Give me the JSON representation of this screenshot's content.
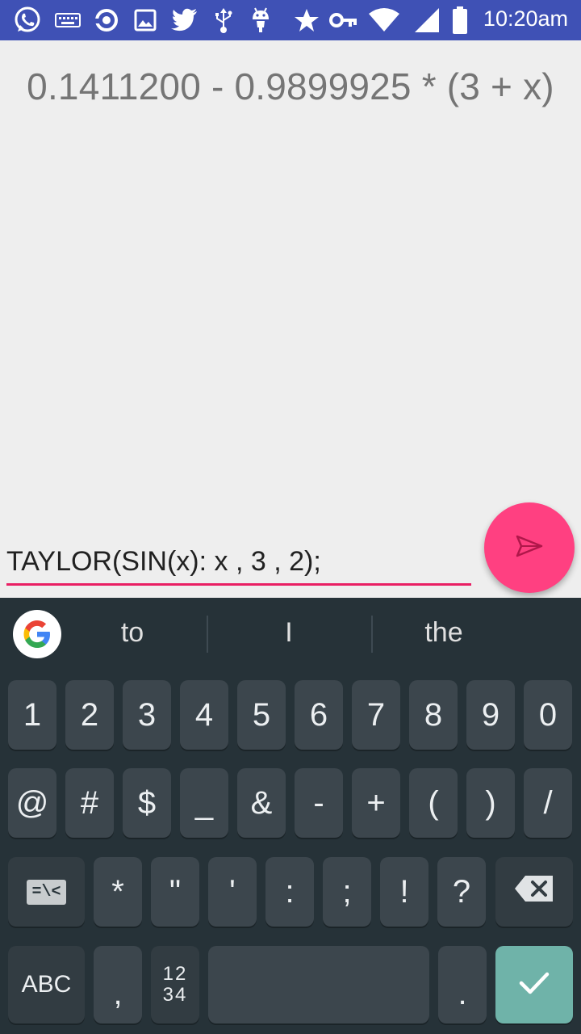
{
  "status_bar": {
    "time": "10:20am",
    "icons": [
      "whatsapp-icon",
      "keyboard-icon",
      "sync-icon",
      "image-icon",
      "twitter-icon",
      "usb-icon",
      "android-icon",
      "star-icon",
      "key-icon",
      "wifi-icon",
      "signal-icon",
      "battery-icon"
    ]
  },
  "result": {
    "text": "0.1411200 - 0.9899925 * (3 + x)"
  },
  "input": {
    "value": "TAYLOR(SIN(x): x , 3 , 2);"
  },
  "fab": {
    "icon": "send-icon",
    "color": "#ff4081"
  },
  "keyboard": {
    "suggestions": [
      "to",
      "I",
      "the"
    ],
    "row1": [
      "1",
      "2",
      "3",
      "4",
      "5",
      "6",
      "7",
      "8",
      "9",
      "0"
    ],
    "row2": [
      "@",
      "#",
      "$",
      "_",
      "&",
      "-",
      "+",
      "(",
      ")",
      "/"
    ],
    "row3": [
      "*",
      "\"",
      "'",
      ":",
      ";",
      "!",
      "?"
    ],
    "row4": {
      "abc": "ABC",
      "comma": ",",
      "numpad_top": "12",
      "numpad_bottom": "34",
      "period": "."
    },
    "symbols_key": "=\\<",
    "accent": "#6fb3a9"
  },
  "colors": {
    "status_bar": "#3f51b5",
    "underline": "#e91e63",
    "keyboard_bg": "#263238"
  }
}
